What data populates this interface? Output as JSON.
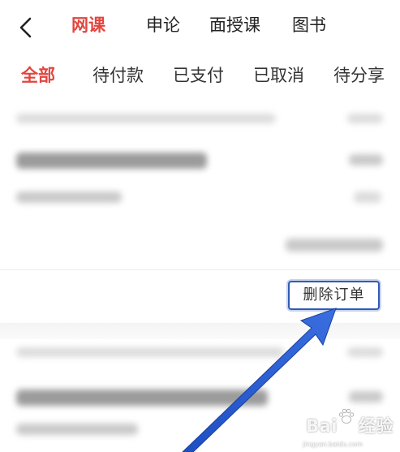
{
  "nav": {
    "tabs": [
      "网课",
      "申论",
      "面授课",
      "图书"
    ],
    "active_index": 0
  },
  "filters": {
    "tabs": [
      "全部",
      "待付款",
      "已支付",
      "已取消",
      "待分享"
    ],
    "active_index": 0
  },
  "order_card": {
    "delete_label": "删除订单"
  },
  "watermark": {
    "brand": "Bai",
    "suffix": "经验",
    "sub": "jingyan.baidu.com"
  },
  "colors": {
    "active": "#e3453e",
    "highlight_border": "#2f5bb5",
    "arrow": "#2a57c8"
  },
  "icons": {
    "back": "chevron-left-icon",
    "watermark": "paw-icon"
  }
}
